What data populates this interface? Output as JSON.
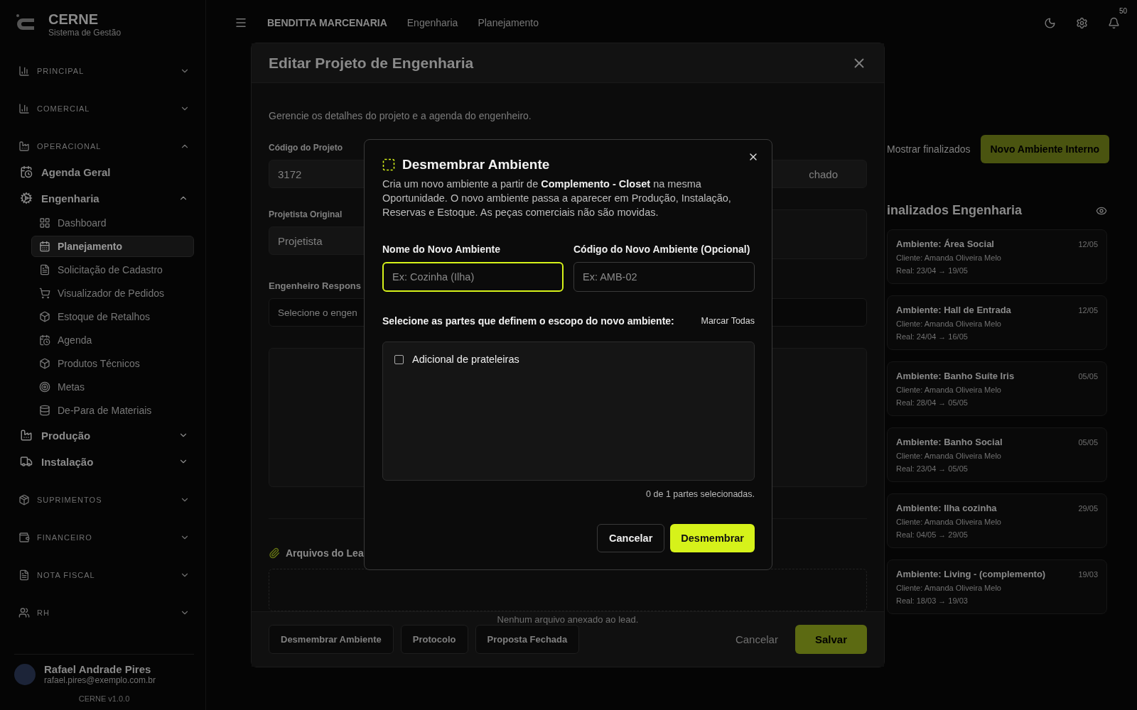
{
  "brand": {
    "name": "CERNE",
    "subtitle": "Sistema de Gestão"
  },
  "sidebar": {
    "sections": [
      {
        "label": "PRINCIPAL",
        "expanded": false
      },
      {
        "label": "COMERCIAL",
        "expanded": false
      },
      {
        "label": "OPERACIONAL",
        "expanded": true,
        "items": [
          {
            "label": "Agenda Geral"
          },
          {
            "label": "Engenharia",
            "expanded": true,
            "children": [
              {
                "label": "Dashboard",
                "selected": false
              },
              {
                "label": "Planejamento",
                "selected": true
              },
              {
                "label": "Solicitação de Cadastro",
                "selected": false
              },
              {
                "label": "Visualizador de Pedidos",
                "selected": false
              },
              {
                "label": "Estoque de Retalhos",
                "selected": false
              },
              {
                "label": "Agenda",
                "selected": false
              },
              {
                "label": "Produtos Técnicos",
                "selected": false
              },
              {
                "label": "Metas",
                "selected": false
              },
              {
                "label": "De-Para de Materiais",
                "selected": false
              }
            ]
          },
          {
            "label": "Produção",
            "expanded": false
          },
          {
            "label": "Instalação",
            "expanded": false
          }
        ]
      },
      {
        "label": "SUPRIMENTOS",
        "expanded": false
      },
      {
        "label": "FINANCEIRO",
        "expanded": false
      },
      {
        "label": "NOTA FISCAL",
        "expanded": false
      },
      {
        "label": "RH",
        "expanded": false
      }
    ],
    "user": {
      "name": "Rafael Andrade Pires",
      "email": "rafael.pires@exemplo.com.br"
    },
    "version": "CERNE v1.0.0"
  },
  "topbar": {
    "breadcrumbs": [
      "BENDITTA MARCENARIA",
      "Engenharia",
      "Planejamento"
    ],
    "notifications": "50"
  },
  "board": {
    "toggle": "Mostrar finalizados",
    "new_button": "Novo Ambiente Interno",
    "column_title": "inalizados Engenharia",
    "cards": [
      {
        "title": "Ambiente: Área Social",
        "date": "12/05",
        "client": "Cliente: Amanda Oliveira Melo",
        "period": "Real: 23/04 → 19/05"
      },
      {
        "title": "Ambiente: Hall de Entrada",
        "date": "12/05",
        "client": "Cliente: Amanda Oliveira Melo",
        "period": "Real: 24/04 → 16/05"
      },
      {
        "title": "Ambiente: Banho Suíte Iris",
        "date": "05/05",
        "client": "Cliente: Amanda Oliveira Melo",
        "period": "Real: 28/04 → 05/05"
      },
      {
        "title": "Ambiente: Banho Social",
        "date": "05/05",
        "client": "Cliente: Amanda Oliveira Melo",
        "period": "Real: 23/04 → 05/05"
      },
      {
        "title": "Ambiente: Ilha cozinha",
        "date": "29/05",
        "client": "Cliente: Amanda Oliveira Melo",
        "period": "Real: 04/05 → 29/05"
      },
      {
        "title": "Ambiente: Living - (complemento)",
        "date": "19/03",
        "client": "Cliente: Amanda Oliveira Melo",
        "period": "Real: 18/03 → 19/03"
      }
    ]
  },
  "edit_modal": {
    "title": "Editar Projeto de Engenharia",
    "description": "Gerencie os detalhes do projeto e a agenda do engenheiro.",
    "code_label": "Código do Projeto",
    "code_value": "3172",
    "status_value": "chado",
    "designer_label": "Projetista Original",
    "designer_value": "Projetista",
    "engineer_label": "Engenheiro Respons",
    "engineer_placeholder": "Selecione o engen",
    "files_title": "Arquivos do Lea",
    "files_empty": "Nenhum arquivo anexado ao lead.",
    "footer_buttons": [
      "Desmembrar Ambiente",
      "Protocolo",
      "Proposta Fechada"
    ],
    "cancel": "Cancelar",
    "save": "Salvar"
  },
  "dialog": {
    "title": "Desmembrar Ambiente",
    "description": "Cria um novo ambiente a partir de **Complemento - Closet** na mesma Oportunidade. O novo ambiente passa a aparecer em Produção, Instalação, Reservas e Estoque. As peças comerciais não são movidas.",
    "fields": [
      {
        "label": "Nome do Novo Ambiente",
        "placeholder": "Ex: Cozinha (Ilha)",
        "focused": true
      },
      {
        "label": "Código do Novo Ambiente (Opcional)",
        "placeholder": "Ex: AMB-02",
        "focused": false
      }
    ],
    "parts_prompt": "Selecione as partes que definem o escopo do novo ambiente:",
    "select_all": "Marcar Todas",
    "parts": [
      {
        "label": "Adicional de prateleiras",
        "checked": false
      }
    ],
    "count": "0 de 1 partes selecionadas.",
    "cancel": "Cancelar",
    "confirm": "Desmembrar"
  }
}
